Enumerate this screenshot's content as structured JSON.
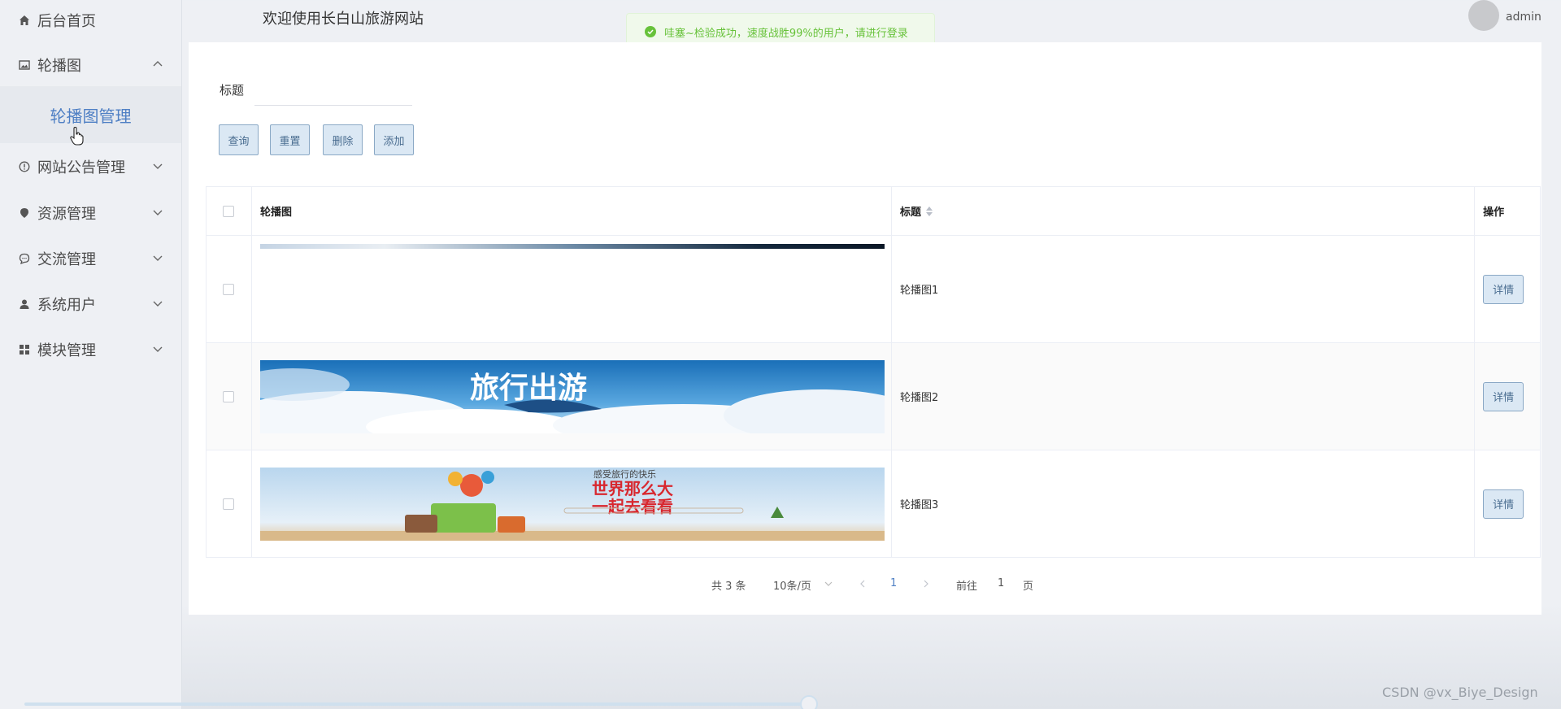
{
  "sidebar": {
    "items": [
      {
        "label": "后台首页",
        "icon": "home-icon"
      },
      {
        "label": "轮播图",
        "icon": "image-icon",
        "expanded": true
      },
      {
        "label": "网站公告管理",
        "icon": "info-icon"
      },
      {
        "label": "资源管理",
        "icon": "location-icon"
      },
      {
        "label": "交流管理",
        "icon": "chat-icon"
      },
      {
        "label": "系统用户",
        "icon": "user-icon"
      },
      {
        "label": "模块管理",
        "icon": "grid-icon"
      }
    ],
    "sub_item": "轮播图管理"
  },
  "header": {
    "title": "欢迎使用长白山旅游网站",
    "toast": "哇塞~检验成功，速度战胜99%的用户，请进行登录",
    "user": "admin"
  },
  "search": {
    "title_label": "标题",
    "title_value": ""
  },
  "toolbar": {
    "query": "查询",
    "reset": "重置",
    "delete": "删除",
    "add": "添加"
  },
  "table": {
    "columns": [
      "轮播图",
      "标题",
      "操作"
    ],
    "rows": [
      {
        "title": "轮播图1",
        "action": "详情"
      },
      {
        "title": "轮播图2",
        "action": "详情",
        "banner_text": "旅行出游"
      },
      {
        "title": "轮播图3",
        "action": "详情",
        "banner_line1": "感受旅行的快乐",
        "banner_line2": "世界那么大",
        "banner_line3": "一起去看看"
      }
    ]
  },
  "pagination": {
    "total": "共 3 条",
    "page_size": "10条/页",
    "current": "1",
    "goto_prefix": "前往",
    "goto_value": "1",
    "goto_suffix": "页"
  },
  "watermark": "CSDN @vx_Biye_Design",
  "colors": {
    "accent": "#4e7fc4",
    "success": "#67c23a",
    "button_bg": "#dbe8f4"
  }
}
